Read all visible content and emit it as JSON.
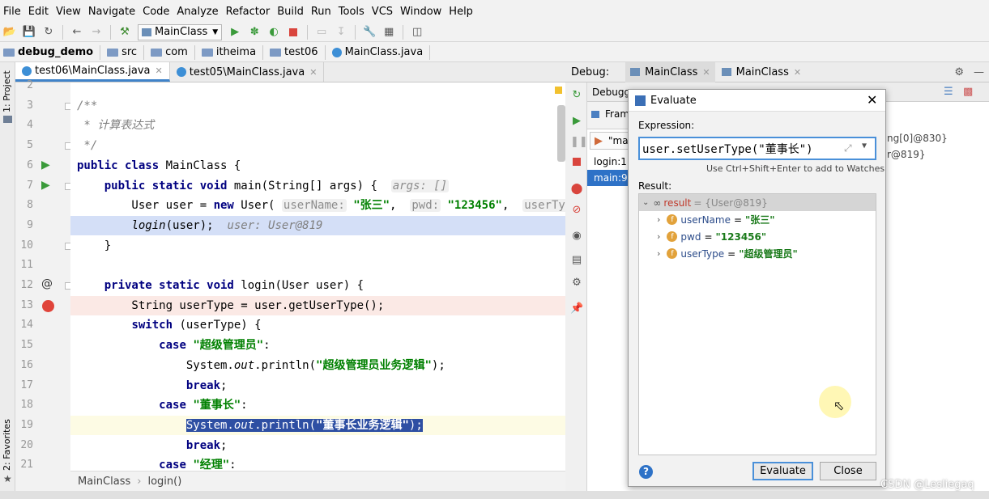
{
  "menu": [
    "File",
    "Edit",
    "View",
    "Navigate",
    "Code",
    "Analyze",
    "Refactor",
    "Build",
    "Run",
    "Tools",
    "VCS",
    "Window",
    "Help"
  ],
  "toolbar": {
    "run_config": "MainClass"
  },
  "breadcrumbs": [
    "debug_demo",
    "src",
    "com",
    "itheima",
    "test06",
    "MainClass.java"
  ],
  "left_strip": {
    "project_label": "1: Project",
    "favorites_label": "2: Favorites"
  },
  "editor": {
    "tabs": [
      {
        "label": "test06\\MainClass.java"
      },
      {
        "label": "test05\\MainClass.java"
      }
    ],
    "lines": [
      {
        "n": "2",
        "html": ""
      },
      {
        "n": "3",
        "html": "<span class=\"cm\">/**</span>"
      },
      {
        "n": "4",
        "html": "<span class=\"cm\"> * 计算表达式</span>"
      },
      {
        "n": "5",
        "html": "<span class=\"cm\"> */</span>"
      },
      {
        "n": "6",
        "html": "<span class=\"kw\">public class</span> MainClass {"
      },
      {
        "n": "7",
        "html": "    <span class=\"kw\">public static void</span> main(String[] args) {  <span class=\"hint it\">args: []</span>"
      },
      {
        "n": "8",
        "html": "        User user = <span class=\"kw\">new</span> User( <span class=\"hint\">userName:</span> <span class=\"st\">\"张三\"</span>,  <span class=\"hint\">pwd:</span> <span class=\"st\">\"123456\"</span>,  <span class=\"hint\">userType:</span>"
      },
      {
        "n": "9",
        "html": "        <span class=\"it\">login</span>(user);  <span class=\"cm\">user: User@819</span>"
      },
      {
        "n": "10",
        "html": "    }"
      },
      {
        "n": "11",
        "html": ""
      },
      {
        "n": "12",
        "html": "    <span class=\"kw\">private static void</span> login(User user) {"
      },
      {
        "n": "13",
        "html": "        String userType = user.getUserType();"
      },
      {
        "n": "14",
        "html": "        <span class=\"kw\">switch</span> (userType) {"
      },
      {
        "n": "15",
        "html": "            <span class=\"kw\">case</span> <span class=\"st\">\"超级管理员\"</span>:"
      },
      {
        "n": "16",
        "html": "                System.<span class=\"it\">out</span>.println(<span class=\"st\">\"超级管理员业务逻辑\"</span>);"
      },
      {
        "n": "17",
        "html": "                <span class=\"kw\">break</span>;"
      },
      {
        "n": "18",
        "html": "            <span class=\"kw\">case</span> <span class=\"st\">\"董事长\"</span>:"
      },
      {
        "n": "19",
        "html": "                System.<span class=\"it\">out</span>.println(<span class=\"st\">\"董事长业务逻辑\"</span>);"
      },
      {
        "n": "20",
        "html": "                <span class=\"kw\">break</span>;"
      },
      {
        "n": "21",
        "html": "            <span class=\"kw\">case</span> <span class=\"st\">\"经理\"</span>:"
      }
    ],
    "statusbar": [
      "MainClass",
      "login()"
    ]
  },
  "debug": {
    "title": "Debug:",
    "tabs": [
      "MainClass",
      "MainClass"
    ],
    "sub_tab": "Debugg",
    "frames_label": "Frames",
    "thread": "\"ma",
    "frames": [
      "login:1",
      "main:9,"
    ],
    "vars_peek": [
      "ng[0]@830}",
      "r@819}"
    ]
  },
  "evaluate": {
    "title": "Evaluate",
    "expression_label": "Expression:",
    "expression": "user.setUserType(\"董事长\")",
    "hint": "Use Ctrl+Shift+Enter to add to Watches",
    "result_label": "Result:",
    "result_root": {
      "name": "result",
      "value": "= {User@819}"
    },
    "fields": [
      {
        "icon": "f",
        "name": "userName",
        "value": "\"张三\""
      },
      {
        "icon": "f",
        "name": "pwd",
        "value": "\"123456\""
      },
      {
        "icon": "f",
        "name": "userType",
        "value": "\"超级管理员\""
      }
    ],
    "evaluate_button": "Evaluate",
    "close_button": "Close",
    "help_icon": "?"
  },
  "watermark": "CSDN @Lesliegaq",
  "colors": {
    "accent": "#4083c9",
    "current_line": "#d4dff7",
    "breakpoint_line": "#fbe9e5",
    "selection": "#2e4fa3",
    "keyword": "#000080",
    "string": "#008000"
  }
}
